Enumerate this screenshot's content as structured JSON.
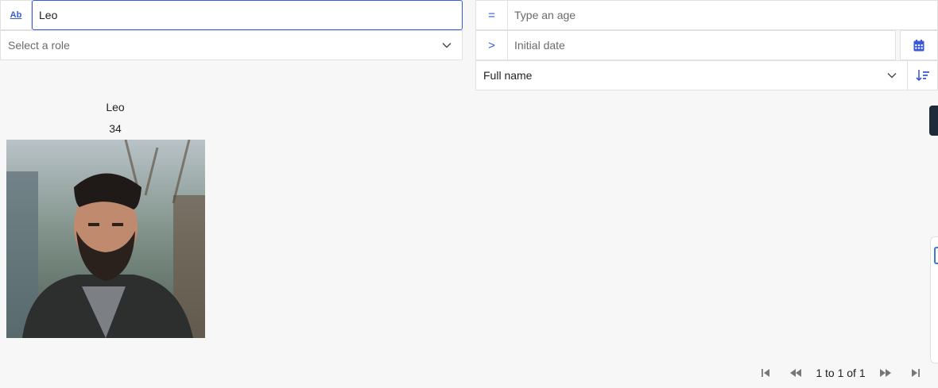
{
  "filters": {
    "text_prefix": "Ab",
    "text_value": "Leo",
    "role_placeholder": "Select a role",
    "age_operator": "=",
    "age_placeholder": "Type an age",
    "date_operator": ">",
    "date_placeholder": "Initial date",
    "sort_value": "Full name"
  },
  "card": {
    "name": "Leo",
    "age": "34"
  },
  "pagination": {
    "info": "1 to 1 of 1"
  },
  "icons": {
    "calendar": "calendar-icon",
    "sort": "sort-descending-icon",
    "chevron": "chevron-down-icon"
  },
  "colors": {
    "accent": "#3b5bd6",
    "background": "#f7f7f7"
  }
}
